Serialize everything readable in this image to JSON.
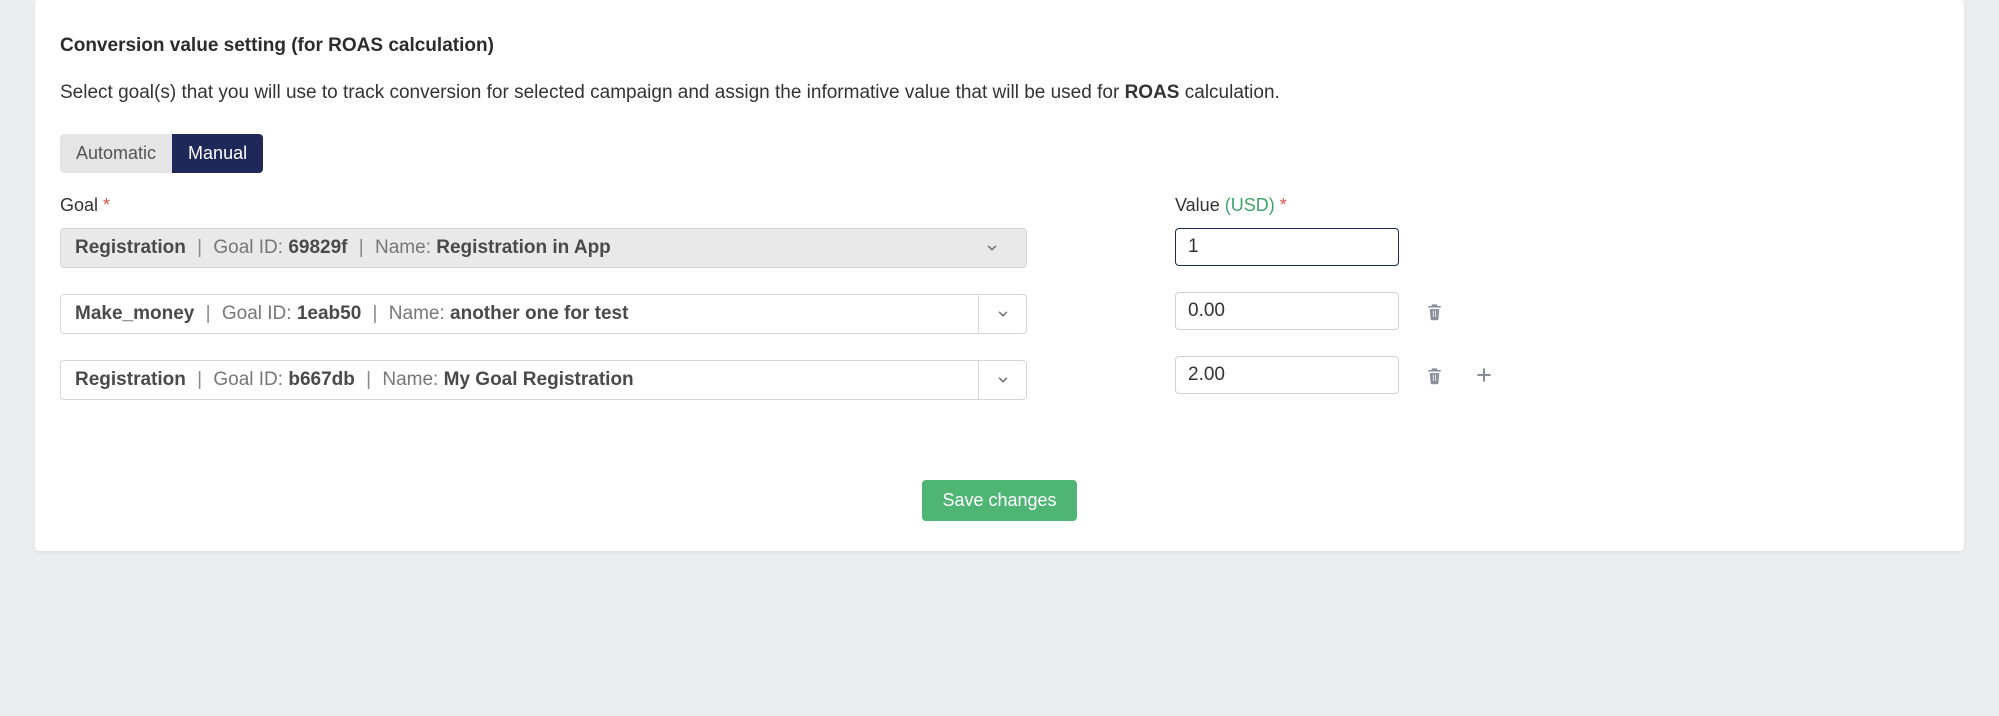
{
  "section": {
    "title": "Conversion value setting (for ROAS calculation)",
    "description_pre": "Select goal(s) that you will use to track conversion for selected campaign and assign the informative value that will be used for ",
    "description_bold": "ROAS",
    "description_post": " calculation."
  },
  "tabs": {
    "automatic": "Automatic",
    "manual": "Manual"
  },
  "labels": {
    "goal": "Goal",
    "value": "Value",
    "usd": "(USD)",
    "goal_id_prefix": "Goal ID: ",
    "name_prefix": "Name: ",
    "separator": " | "
  },
  "rows": [
    {
      "key": "Registration",
      "goal_id": "69829f",
      "name": "Registration in App",
      "value": "1",
      "disabled": true,
      "show_delete": false,
      "show_add": false,
      "split_chevron": false,
      "value_focused": true
    },
    {
      "key": "Make_money",
      "goal_id": "1eab50",
      "name": "another one for test",
      "value": "0.00",
      "disabled": false,
      "show_delete": true,
      "show_add": false,
      "split_chevron": true,
      "value_focused": false
    },
    {
      "key": "Registration",
      "goal_id": "b667db",
      "name": "My Goal Registration",
      "value": "2.00",
      "disabled": false,
      "show_delete": true,
      "show_add": true,
      "split_chevron": true,
      "value_focused": false
    }
  ],
  "buttons": {
    "save": "Save changes"
  }
}
